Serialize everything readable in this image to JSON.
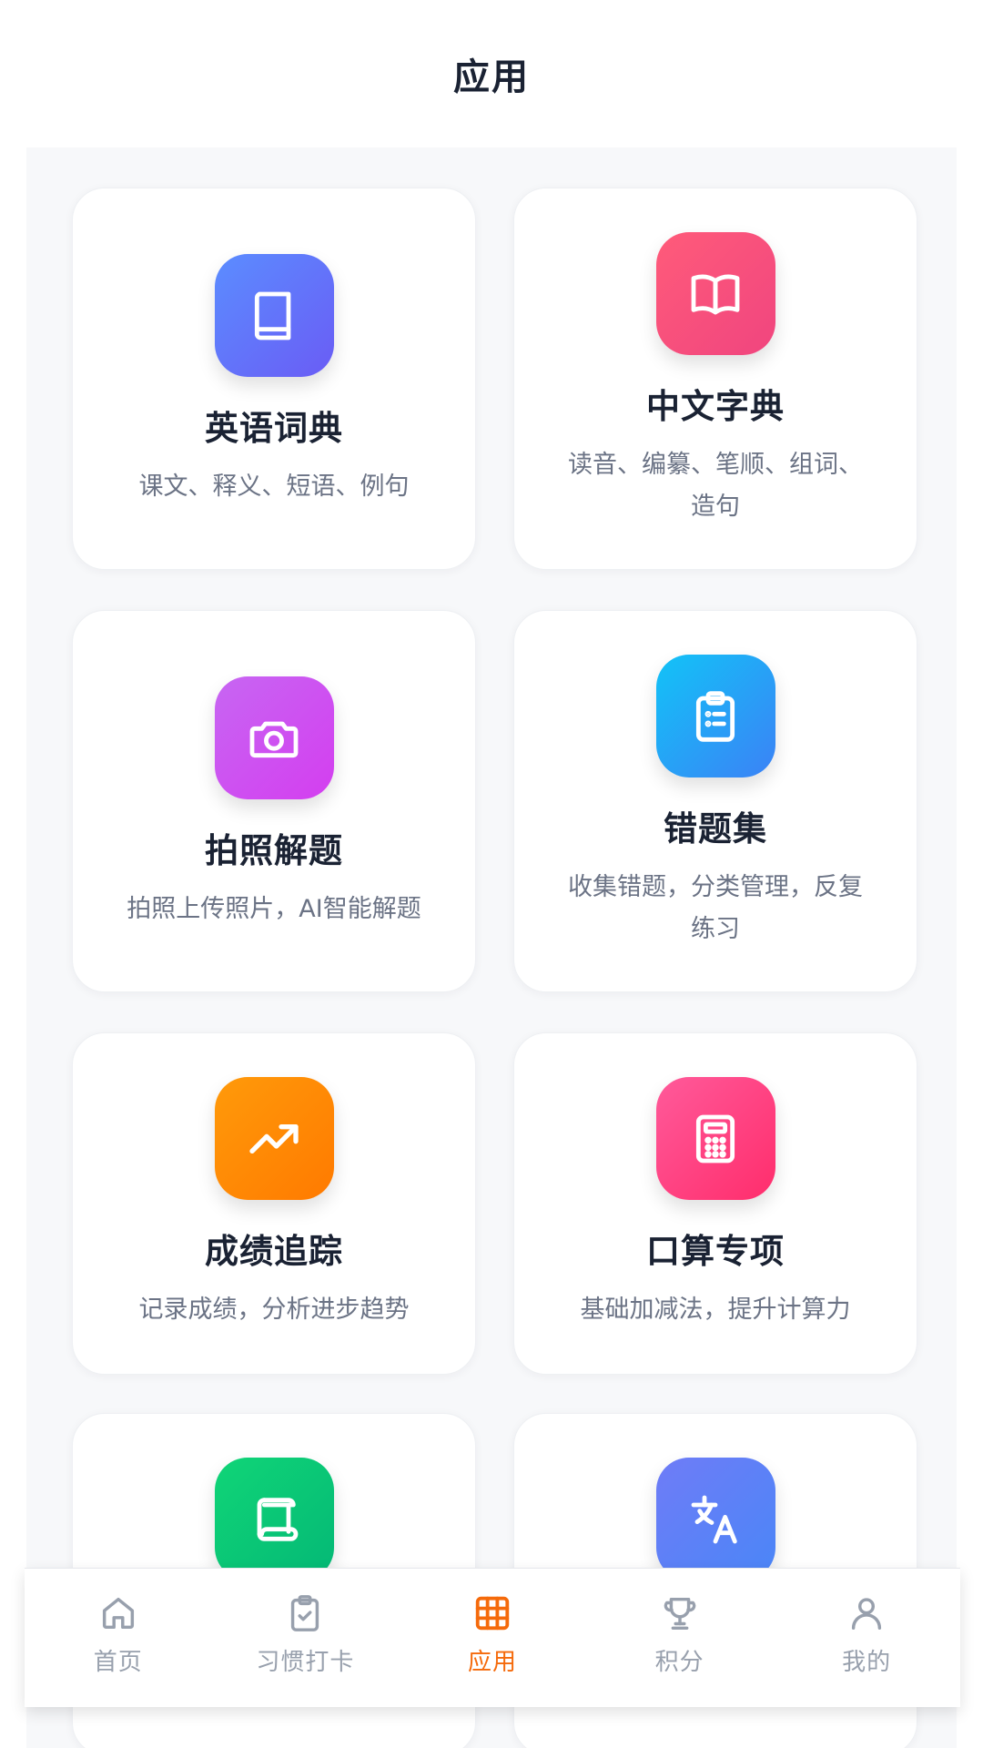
{
  "header": {
    "title": "应用"
  },
  "apps": [
    {
      "title": "英语词典",
      "desc": "课文、释义、短语、例句",
      "icon": "book-icon",
      "gradient": [
        "#5b8dff",
        "#6a5cf5"
      ]
    },
    {
      "title": "中文字典",
      "desc": "读音、编纂、笔顺、组词、造句",
      "icon": "book-open-icon",
      "gradient": [
        "#ff5b7a",
        "#f0457f"
      ]
    },
    {
      "title": "拍照解题",
      "desc": "拍照上传照片，AI智能解题",
      "icon": "camera-icon",
      "gradient": [
        "#c766f2",
        "#d43ef0"
      ]
    },
    {
      "title": "错题集",
      "desc": "收集错题，分类管理，反复练习",
      "icon": "clipboard-icon",
      "gradient": [
        "#12c3f7",
        "#3b82f6"
      ]
    },
    {
      "title": "成绩追踪",
      "desc": "记录成绩，分析进步趋势",
      "icon": "trending-up-icon",
      "gradient": [
        "#ff9a0a",
        "#ff7a00"
      ]
    },
    {
      "title": "口算专项",
      "desc": "基础加减法，提升计算力",
      "icon": "calculator-icon",
      "gradient": [
        "#ff5a9a",
        "#ff2d6c"
      ]
    },
    {
      "title": "",
      "desc": "",
      "icon": "scroll-icon",
      "gradient": [
        "#10d577",
        "#04b876"
      ]
    },
    {
      "title": "",
      "desc": "",
      "icon": "translate-icon",
      "gradient": [
        "#6f7cf7",
        "#4a86f7"
      ]
    }
  ],
  "nav": {
    "items": [
      {
        "label": "首页",
        "icon": "home-icon",
        "active": false
      },
      {
        "label": "习惯打卡",
        "icon": "clipboard-check-icon",
        "active": false
      },
      {
        "label": "应用",
        "icon": "grid-icon",
        "active": true
      },
      {
        "label": "积分",
        "icon": "trophy-icon",
        "active": false
      },
      {
        "label": "我的",
        "icon": "user-icon",
        "active": false
      }
    ]
  },
  "colors": {
    "accent": "#f56a0b",
    "nav_inactive": "#98a0ad",
    "title_text": "#1a2233",
    "desc_text": "#6b7385",
    "content_bg": "#f7f8fa"
  }
}
